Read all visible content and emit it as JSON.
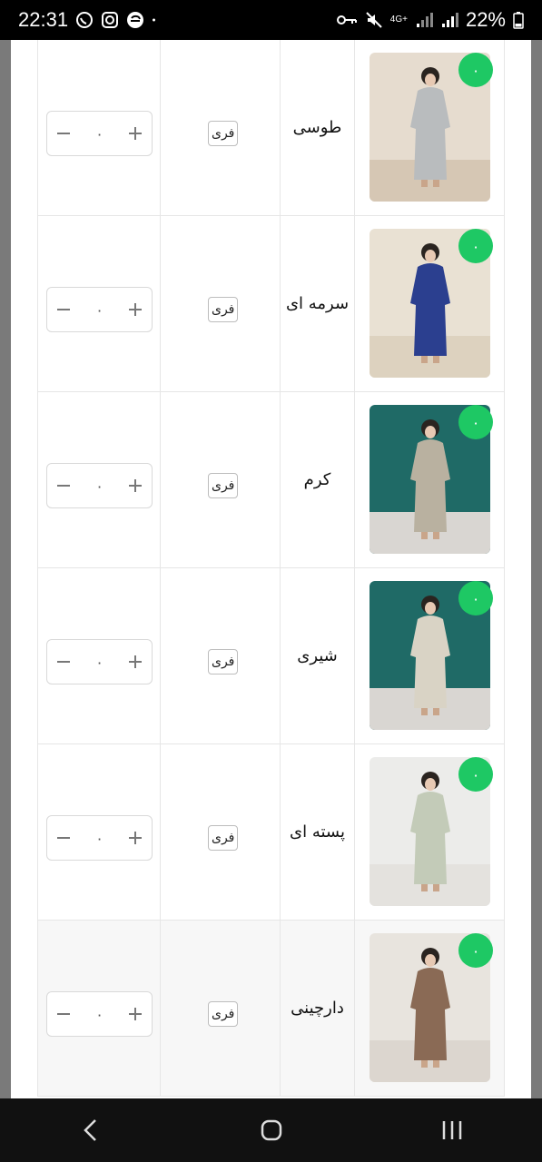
{
  "status_bar": {
    "time": "22:31",
    "network": "4G+",
    "battery": "22%"
  },
  "accent_color": "#1ec864",
  "rows": [
    {
      "color": "طوسی",
      "size": "فری",
      "quantity": "۰",
      "badge": "۰",
      "dress_color": "#b9bcbe",
      "wall": "#e6dccf",
      "floor": "#d6c7b4"
    },
    {
      "color": "سرمه ای",
      "size": "فری",
      "quantity": "۰",
      "badge": "۰",
      "dress_color": "#2b3f8f",
      "wall": "#e9e1d3",
      "floor": "#ddd2bf"
    },
    {
      "color": "کرم",
      "size": "فری",
      "quantity": "۰",
      "badge": "۰",
      "dress_color": "#b9b1a0",
      "wall": "#1f6a66",
      "floor": "#d9d6d2"
    },
    {
      "color": "شیری",
      "size": "فری",
      "quantity": "۰",
      "badge": "۰",
      "dress_color": "#d9d3c5",
      "wall": "#1f6a66",
      "floor": "#d9d6d2"
    },
    {
      "color": "پسته ای",
      "size": "فری",
      "quantity": "۰",
      "badge": "۰",
      "dress_color": "#c3cbb8",
      "wall": "#ececea",
      "floor": "#e4e2de"
    },
    {
      "color": "دارچینی",
      "size": "فری",
      "quantity": "۰",
      "badge": "۰",
      "dress_color": "#8a6a55",
      "wall": "#e8e4de",
      "floor": "#dcd6cf"
    }
  ],
  "icons": {
    "minus": "minus-icon",
    "plus": "plus-icon",
    "back": "back-icon",
    "home": "home-icon",
    "recents": "recents-icon"
  }
}
